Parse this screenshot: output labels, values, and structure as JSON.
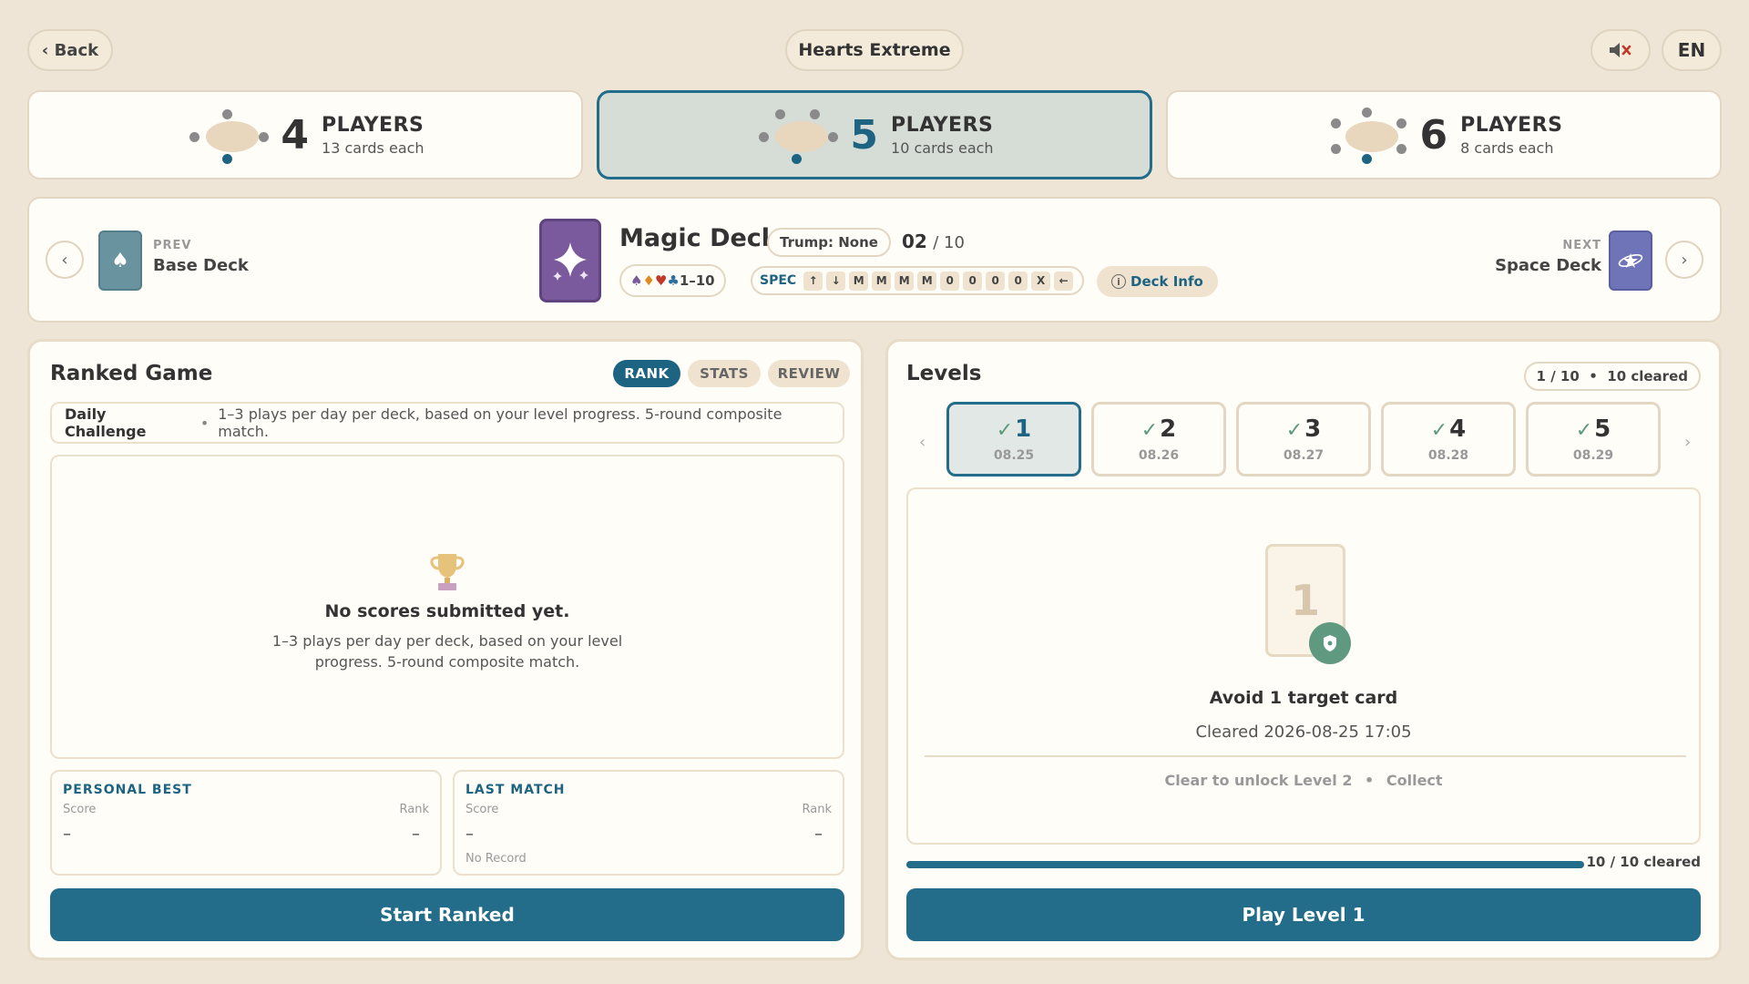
{
  "topbar": {
    "back_label": "‹ Back",
    "title": "Hearts Extreme",
    "lang": "EN"
  },
  "players": [
    {
      "count": "4",
      "label": "PLAYERS",
      "sub": "13 cards each",
      "active": false
    },
    {
      "count": "5",
      "label": "PLAYERS",
      "sub": "10 cards each",
      "active": true
    },
    {
      "count": "6",
      "label": "PLAYERS",
      "sub": "8 cards each",
      "active": false
    }
  ],
  "deck": {
    "prev_label": "PREV",
    "prev_name": "Base Deck",
    "current_name": "Magic Deck",
    "trump": "Trump: None",
    "index": "02",
    "total": "/ 10",
    "range": "1–10",
    "spec_label": "SPEC",
    "spec_keys": [
      "↑",
      "↓",
      "M",
      "M",
      "M",
      "M",
      "0",
      "0",
      "0",
      "0",
      "X",
      "←"
    ],
    "info_label": "Deck Info",
    "next_label": "NEXT",
    "next_name": "Space Deck",
    "colors": {
      "prev": "#6a93a0",
      "current": "#7a5a9c",
      "next": "#6f74b8"
    }
  },
  "ranked": {
    "title": "Ranked Game",
    "tabs": [
      "RANK",
      "STATS",
      "REVIEW"
    ],
    "daily_title": "Daily Challenge",
    "daily_desc": "1–3 plays per day per deck, based on your level progress. 5-round composite match.",
    "empty_title": "No scores submitted yet.",
    "empty_desc": "1–3 plays per day per deck, based on your level progress. 5-round composite match.",
    "personal_best": {
      "title": "PERSONAL BEST",
      "score_label": "Score",
      "rank_label": "Rank",
      "score": "–",
      "rank": "–"
    },
    "last_match": {
      "title": "LAST MATCH",
      "score_label": "Score",
      "rank_label": "Rank",
      "score": "–",
      "rank": "–",
      "note": "No Record"
    },
    "start_label": "Start Ranked"
  },
  "levels": {
    "title": "Levels",
    "summary": "1 / 10  •  10 cleared",
    "items": [
      {
        "num": "1",
        "date": "08.25"
      },
      {
        "num": "2",
        "date": "08.26"
      },
      {
        "num": "3",
        "date": "08.27"
      },
      {
        "num": "4",
        "date": "08.28"
      },
      {
        "num": "5",
        "date": "08.29"
      }
    ],
    "check": "✓",
    "card_num": "1",
    "goal": "Avoid 1 target card",
    "cleared": "Cleared 2026-08-25 17:05",
    "unlock": "Clear to unlock Level 2",
    "collect": "Collect",
    "progress_text": "10 / 10 cleared",
    "progress_fraction": 1.0,
    "play_label": "Play Level 1"
  }
}
